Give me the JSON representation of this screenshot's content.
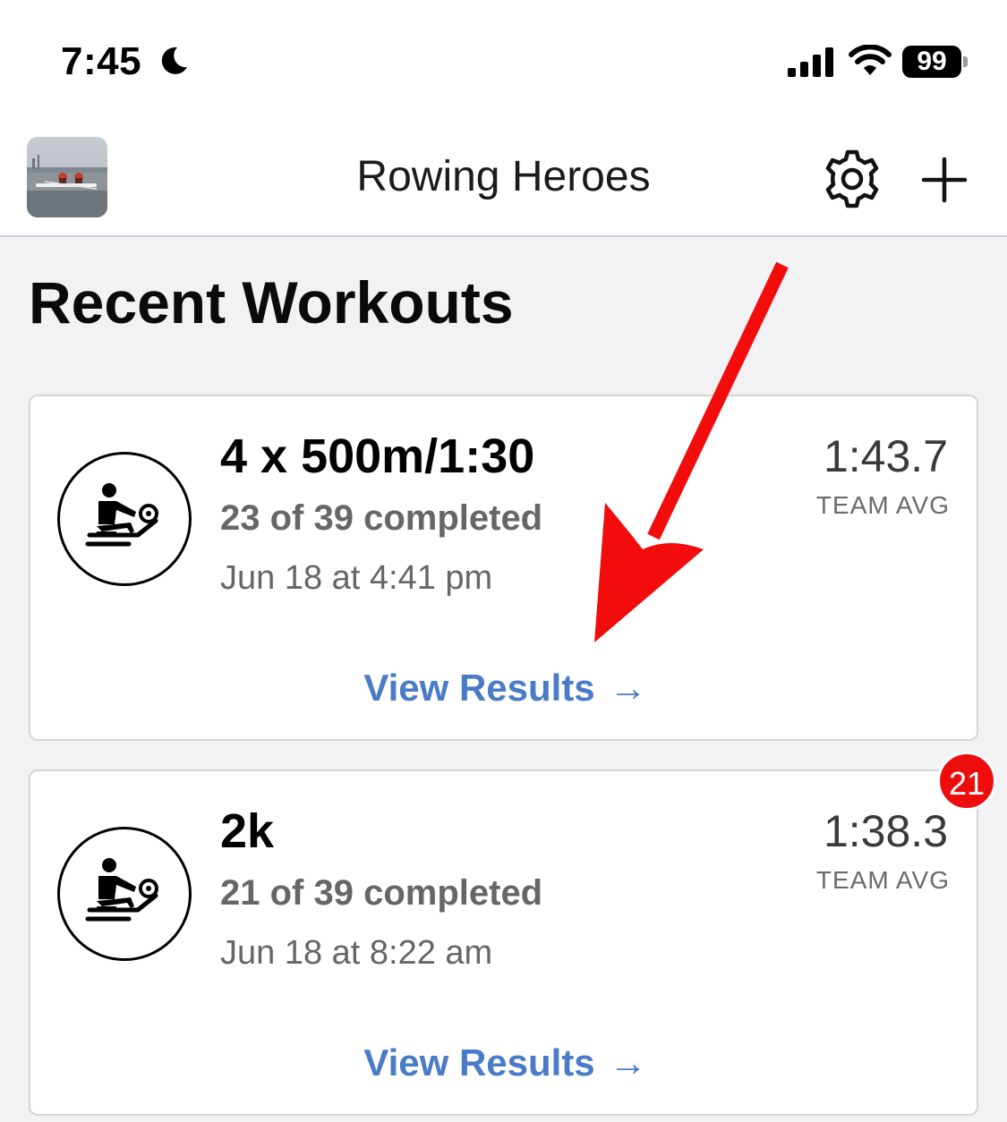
{
  "status_bar": {
    "time": "7:45",
    "battery": "99",
    "icons": [
      "moon-icon",
      "signal-icon",
      "wifi-icon",
      "battery-icon"
    ]
  },
  "header": {
    "title": "Rowing Heroes",
    "icons": [
      "avatar",
      "gear-icon",
      "plus-icon"
    ]
  },
  "section_title": "Recent Workouts",
  "workouts": [
    {
      "title": "4 x 500m/1:30",
      "completed": "23 of 39 completed",
      "date": "Jun 18 at 4:41 pm",
      "avg_time": "1:43.7",
      "avg_label": "TEAM AVG",
      "action": "View Results",
      "action_arrow": "→",
      "icon": "rower-icon"
    },
    {
      "title": "2k",
      "completed": "21 of 39 completed",
      "date": "Jun 18 at 8:22 am",
      "avg_time": "1:38.3",
      "avg_label": "TEAM AVG",
      "action": "View Results",
      "action_arrow": "→",
      "icon": "rower-icon",
      "badge": "21"
    }
  ],
  "colors": {
    "accent": "#4a7bc6",
    "badge": "#ee0d0d",
    "annotation": "#f20c0c",
    "background": "#f2f2f4"
  }
}
